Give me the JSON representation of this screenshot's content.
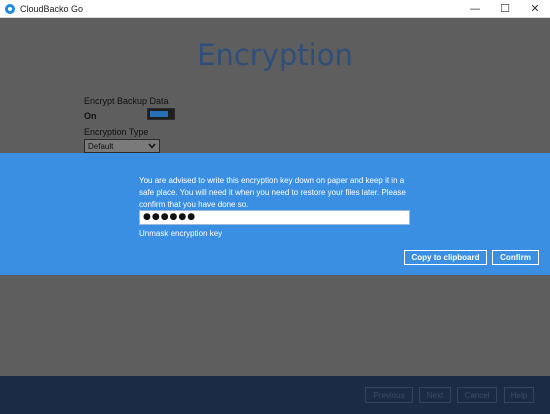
{
  "window": {
    "title": "CloudBacko Go",
    "controls": {
      "minimize": "—",
      "maximize": "☐",
      "close": "✕"
    }
  },
  "page": {
    "title": "Encryption",
    "encrypt_label": "Encrypt Backup Data",
    "encrypt_state": "On",
    "encrypt_on": true,
    "type_label": "Encryption Type",
    "type_value": "Default"
  },
  "dialog": {
    "message": "You are advised to write this encryption key down on paper and keep it in a safe place. You will need it when you need to restore your files later. Please confirm that you have done so.",
    "masked_key": "●●●●●●",
    "unmask_label": "Unmask encryption key",
    "copy_label": "Copy to clipboard",
    "confirm_label": "Confirm"
  },
  "footer": {
    "previous_label": "Previous",
    "next_label": "Next",
    "cancel_label": "Cancel",
    "help_label": "Help"
  },
  "colors": {
    "dialog": "#3b8fe3",
    "overlay": "#5e5e5e",
    "footer": "#1c2b45",
    "title": "#2f4f7a"
  }
}
